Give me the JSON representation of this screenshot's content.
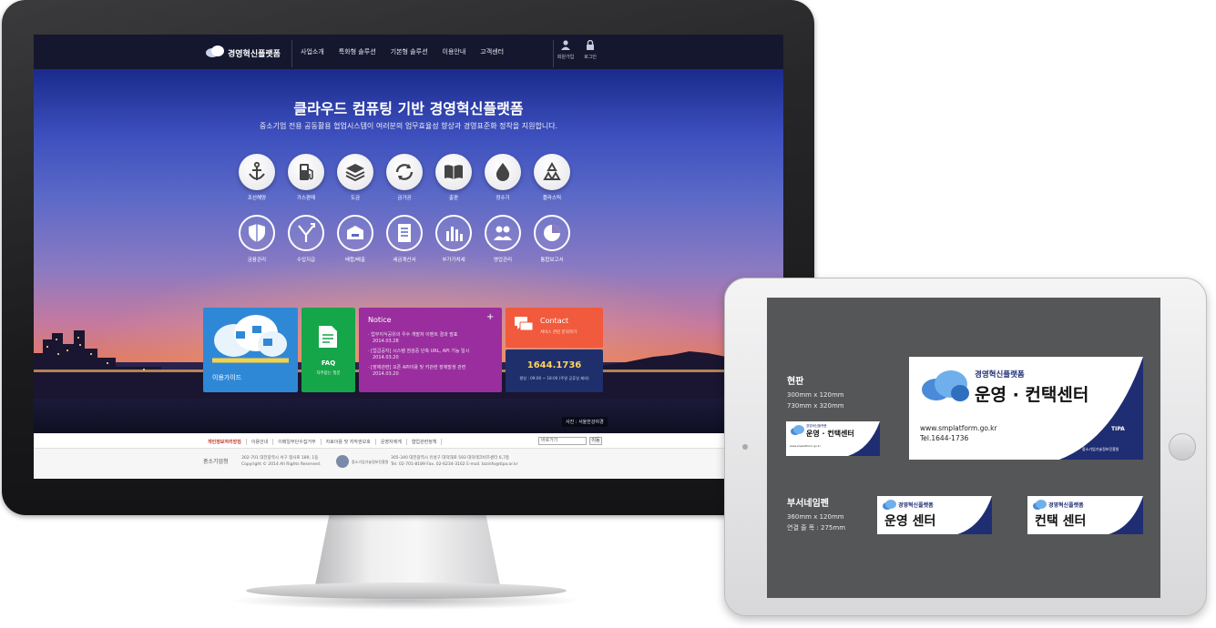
{
  "site": {
    "logo_text": "경영혁신플랫폼",
    "nav": [
      "사업소개",
      "특화형 솔루션",
      "기본형 솔루션",
      "이용안내",
      "고객센터"
    ],
    "util": [
      "회원가입",
      "로그인"
    ]
  },
  "hero": {
    "title": "클라우드 컴퓨팅 기반 경영혁신플랫폼",
    "subtitle": "중소기업 전용 공동활용 협업시스템이 여러분의 업무효율성 향상과 경영표준화 정착을 지원합니다.",
    "row1": [
      {
        "label": "조선해양",
        "icon": "anchor-icon"
      },
      {
        "label": "가스판매",
        "icon": "gas-pump-icon"
      },
      {
        "label": "도금",
        "icon": "layers-icon"
      },
      {
        "label": "금가공",
        "icon": "recycle-arrows-icon"
      },
      {
        "label": "출판",
        "icon": "book-icon"
      },
      {
        "label": "정수기",
        "icon": "water-drop-icon"
      },
      {
        "label": "플라스틱",
        "icon": "recycle-icon"
      }
    ],
    "row2": [
      {
        "label": "금융관리",
        "icon": "shield-icon"
      },
      {
        "label": "수입지급",
        "icon": "arrows-icon"
      },
      {
        "label": "배합/배출",
        "icon": "box-icon"
      },
      {
        "label": "세금계산서",
        "icon": "document-icon"
      },
      {
        "label": "부가가치세",
        "icon": "bar-chart-icon"
      },
      {
        "label": "영업관리",
        "icon": "users-icon"
      },
      {
        "label": "통합보고서",
        "icon": "pie-chart-icon"
      }
    ]
  },
  "tiles": {
    "guide_label": "이용가이드",
    "faq_title": "FAQ",
    "faq_sub": "자주묻는 질문",
    "notice_title": "Notice",
    "notice_items": [
      {
        "text": "· 업무지식공유의 우수 개발자 이벤트 결과 발표",
        "date": "2014.03.28"
      },
      {
        "text": "· [업급공지] 시스템 점검중 단축 URL, API 기능 일시",
        "date": "2014.03.20"
      },
      {
        "text": "· [장애관련] 오픈 API이용 및 키관련 장애발생 관련",
        "date": "2014.03.20"
      }
    ],
    "contact_title": "Contact",
    "contact_sub": "서비스 관련 문의하기",
    "phone": "1644.1736",
    "hours": "평일 : 09:00 ~ 18:00 (주말 공휴일 제외)"
  },
  "photo_credit": "사진 : 서울한강야경",
  "footer": {
    "nav": [
      "개인정보처리방침",
      "이용안내",
      "이메일무단수집거부",
      "자료이용 및 저작권보호",
      "운영자에게",
      "협업관련정책"
    ],
    "select_value": "바로가기",
    "go_label": "이동",
    "left_org": "중소기업청",
    "left_addr": "302-701 대전광역시 서구 청사로 189, 1동",
    "copyright": "Copyright © 2014 All Rights Reserved.",
    "right_org": "중소기업기술정보진흥원",
    "right_addr": "305-340 대전광역시 유성구 대덕대로 593 대덕테크비즈센터 6,7층",
    "right_contact": "Tel. 02-701-8189  Fax. 02-6234-3102  E-mail. bizinfo@tipa.or.kr"
  },
  "tablet": {
    "sign1_heading": "현판",
    "sign1_specs": [
      "300mm x 120mm",
      "730mm x 320mm"
    ],
    "sign2_heading": "부서네임펜",
    "sign2_specs": [
      "360mm x 120mm",
      "연결 줄 폭 : 275mm"
    ],
    "sign_brand": "경영혁신플랫폼",
    "sign_main": "운영 · 컨택센터",
    "sign_url": "www.smplatform.go.kr",
    "sign_tel": "Tel.1644-1736",
    "sign_org": "중소기업기술정보진흥원",
    "sign_logo": "TIPA",
    "small1_main": "운영 · 컨택센터",
    "small2_main": "운영 센터",
    "small3_main": "컨택 센터"
  },
  "colors": {
    "navy": "#1f2d72",
    "notice": "#9a2e9e",
    "faq": "#16a64a",
    "guide": "#2f88d6",
    "contact": "#f15a3c"
  }
}
